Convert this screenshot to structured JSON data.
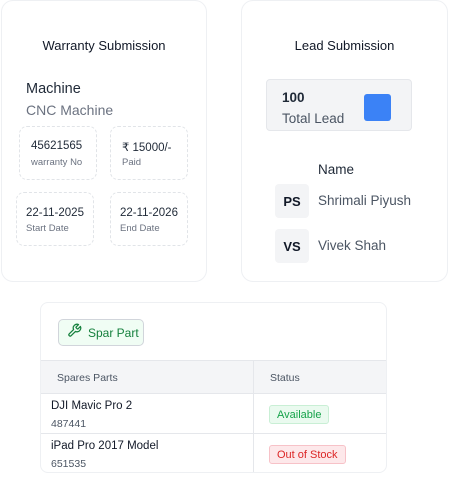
{
  "warranty": {
    "title": "Warranty Submission",
    "machine_label": "Machine",
    "machine_value": "CNC Machine",
    "fields": [
      {
        "value": "45621565",
        "label": "warranty No"
      },
      {
        "value": "₹ 15000/-",
        "label": "Paid"
      },
      {
        "value": "22-11-2025",
        "label": "Start Date"
      },
      {
        "value": "22-11-2026",
        "label": "End Date"
      }
    ]
  },
  "lead": {
    "title": "Lead Submission",
    "count": "100",
    "count_label": "Total Lead",
    "accent_color": "#3b82f6",
    "name_header": "Name",
    "people": [
      {
        "initials": "PS",
        "name": "Shrimali Piyush"
      },
      {
        "initials": "VS",
        "name": "Vivek Shah"
      }
    ]
  },
  "spare": {
    "button_label": "Spar Part",
    "button_icon": "wrench-icon",
    "columns": [
      "Spares Parts",
      "Status"
    ],
    "rows": [
      {
        "name": "DJI Mavic Pro 2",
        "id": "487441",
        "status": "Available",
        "status_type": "ok"
      },
      {
        "name": "iPad Pro 2017 Model",
        "id": "651535",
        "status": "Out of Stock",
        "status_type": "bad"
      }
    ]
  }
}
